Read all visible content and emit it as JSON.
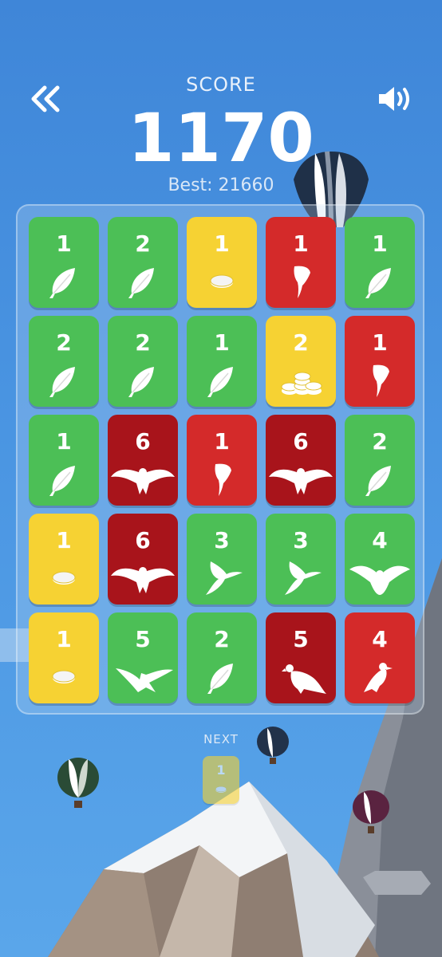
{
  "header": {
    "back_icon": "double-chevron-left-icon",
    "sound_icon": "speaker-on-icon",
    "score_label": "SCORE",
    "score_value": "1170",
    "best_label": "Best: 21660"
  },
  "colors": {
    "green": "#4cbf56",
    "yellow": "#f6d233",
    "red": "#d42a2a",
    "darkred": "#a8141b",
    "sky": "#4a95e2"
  },
  "board": {
    "rows": [
      [
        {
          "value": "1",
          "color": "green",
          "icon": "feather-icon"
        },
        {
          "value": "2",
          "color": "green",
          "icon": "feather-icon"
        },
        {
          "value": "1",
          "color": "yellow",
          "icon": "coin-icon"
        },
        {
          "value": "1",
          "color": "red",
          "icon": "claw-icon"
        },
        {
          "value": "1",
          "color": "green",
          "icon": "feather-icon"
        }
      ],
      [
        {
          "value": "2",
          "color": "green",
          "icon": "feather-icon"
        },
        {
          "value": "2",
          "color": "green",
          "icon": "feather-icon"
        },
        {
          "value": "1",
          "color": "green",
          "icon": "feather-icon"
        },
        {
          "value": "2",
          "color": "yellow",
          "icon": "coin-stack-icon"
        },
        {
          "value": "1",
          "color": "red",
          "icon": "claw-icon"
        }
      ],
      [
        {
          "value": "1",
          "color": "green",
          "icon": "feather-icon"
        },
        {
          "value": "6",
          "color": "darkred",
          "icon": "eagle-icon"
        },
        {
          "value": "1",
          "color": "red",
          "icon": "claw-icon"
        },
        {
          "value": "6",
          "color": "darkred",
          "icon": "eagle-icon"
        },
        {
          "value": "2",
          "color": "green",
          "icon": "feather-icon"
        }
      ],
      [
        {
          "value": "1",
          "color": "yellow",
          "icon": "coin-icon"
        },
        {
          "value": "6",
          "color": "darkred",
          "icon": "eagle-icon"
        },
        {
          "value": "3",
          "color": "green",
          "icon": "hummingbird-icon"
        },
        {
          "value": "3",
          "color": "green",
          "icon": "hummingbird-icon"
        },
        {
          "value": "4",
          "color": "green",
          "icon": "dove-icon"
        }
      ],
      [
        {
          "value": "1",
          "color": "yellow",
          "icon": "coin-icon"
        },
        {
          "value": "5",
          "color": "green",
          "icon": "soaring-bird-icon"
        },
        {
          "value": "2",
          "color": "green",
          "icon": "feather-icon"
        },
        {
          "value": "5",
          "color": "darkred",
          "icon": "vulture-icon"
        },
        {
          "value": "4",
          "color": "red",
          "icon": "crow-icon"
        }
      ]
    ]
  },
  "next": {
    "label": "NEXT",
    "value": "1",
    "color": "yellow",
    "icon": "coin-icon"
  }
}
